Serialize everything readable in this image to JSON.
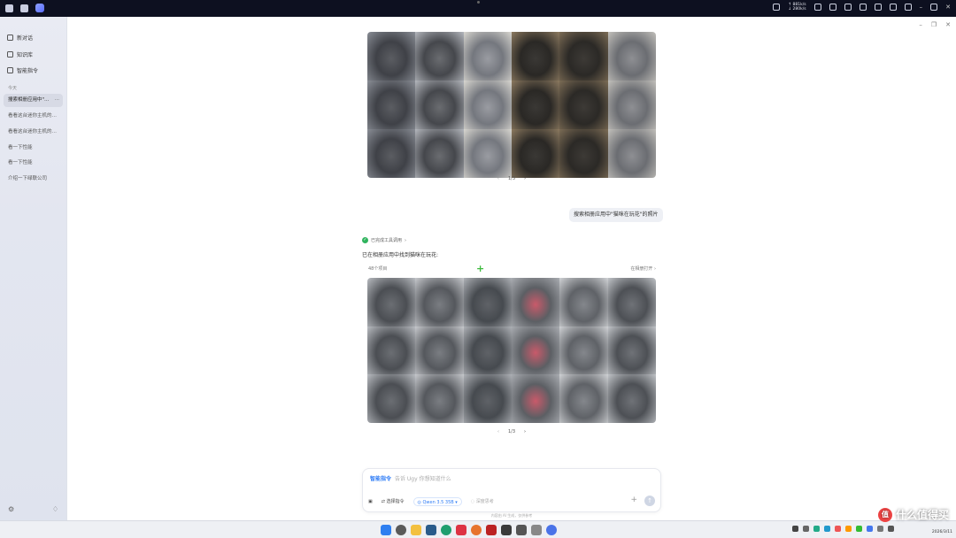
{
  "system_bar": {
    "net_up": "↑ 881k/s",
    "net_down": "↓ 280k/s"
  },
  "sidebar": {
    "items": [
      {
        "label": "新对话",
        "icon": "chat-plus-icon"
      },
      {
        "label": "知识库",
        "icon": "book-icon"
      },
      {
        "label": "智能指令",
        "icon": "magic-icon"
      }
    ],
    "section_today": "今天",
    "history": [
      {
        "label": "搜索相册应用中\"…",
        "active": true
      },
      {
        "label": "看看这台迷你主机的…",
        "active": false
      },
      {
        "label": "看看这台迷你主机的…",
        "active": false
      },
      {
        "label": "看一下性能",
        "active": false
      },
      {
        "label": "看一下性能",
        "active": false
      },
      {
        "label": "介绍一下绿联公司",
        "active": false
      }
    ],
    "more_label": "···"
  },
  "chat": {
    "pager1": {
      "prev": "‹",
      "page": "1/3",
      "next": "›"
    },
    "user_message": "搜索相册应用中\"猫咪在玩花\"的照片",
    "tool_status": "已完成工具调用",
    "tool_status_arrow": "›",
    "answer_text": "已在相册应用中找到猫咪在玩花:",
    "results_count": "48个项目",
    "open_in_album": "在相册打开 ›",
    "pager2": {
      "prev": "‹",
      "page": "1/3",
      "next": "›"
    }
  },
  "input": {
    "command_label": "智能指令",
    "placeholder": "告诉 Ugy 你想知道什么",
    "tool_select": "选择指令",
    "model": "Qwen 3.5 35B",
    "deep_think": "深度思考",
    "plus": "+",
    "send": "↑"
  },
  "disclaimer": "内容由 AI 生成，仅供参考",
  "taskbar": {
    "date": "2026/3/11",
    "watermark": "什么值得买",
    "watermark_badge": "值"
  }
}
